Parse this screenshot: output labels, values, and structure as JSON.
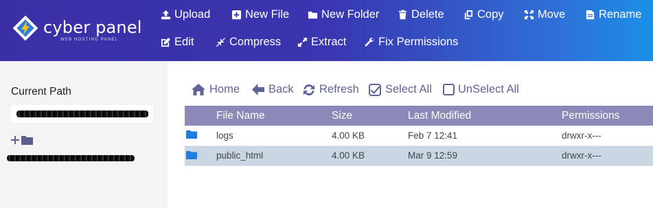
{
  "brand": {
    "name": "cyber panel",
    "tagline": "WEB HOSTING PANEL"
  },
  "toolbar": {
    "row1": [
      {
        "label": "Upload",
        "icon": "upload-icon"
      },
      {
        "label": "New File",
        "icon": "plus-square-icon"
      },
      {
        "label": "New Folder",
        "icon": "folder-icon"
      },
      {
        "label": "Delete",
        "icon": "trash-icon"
      },
      {
        "label": "Copy",
        "icon": "copy-icon"
      },
      {
        "label": "Move",
        "icon": "move-icon"
      },
      {
        "label": "Rename",
        "icon": "file-text-icon"
      }
    ],
    "row2": [
      {
        "label": "Edit",
        "icon": "edit-icon"
      },
      {
        "label": "Compress",
        "icon": "compress-icon"
      },
      {
        "label": "Extract",
        "icon": "expand-icon"
      },
      {
        "label": "Fix Permissions",
        "icon": "wrench-icon"
      }
    ]
  },
  "sidebar": {
    "current_path_label": "Current Path"
  },
  "nav": {
    "home": "Home",
    "back": "Back",
    "refresh": "Refresh",
    "select_all": "Select All",
    "unselect_all": "UnSelect All"
  },
  "table": {
    "headers": [
      "File Name",
      "Size",
      "Last Modified",
      "Permissions"
    ],
    "rows": [
      {
        "name": "logs",
        "size": "4.00 KB",
        "modified": "Feb 7 12:41",
        "permissions": "drwxr-x---",
        "selected": false
      },
      {
        "name": "public_html",
        "size": "4.00 KB",
        "modified": "Mar 9 12:59",
        "permissions": "drwxr-x---",
        "selected": true
      }
    ]
  },
  "colors": {
    "header_start": "#3b2fa6",
    "header_end": "#1b8fe6",
    "table_header": "#8b89b7",
    "selected_row": "#c9d7e4",
    "nav_text": "#5f6496"
  }
}
